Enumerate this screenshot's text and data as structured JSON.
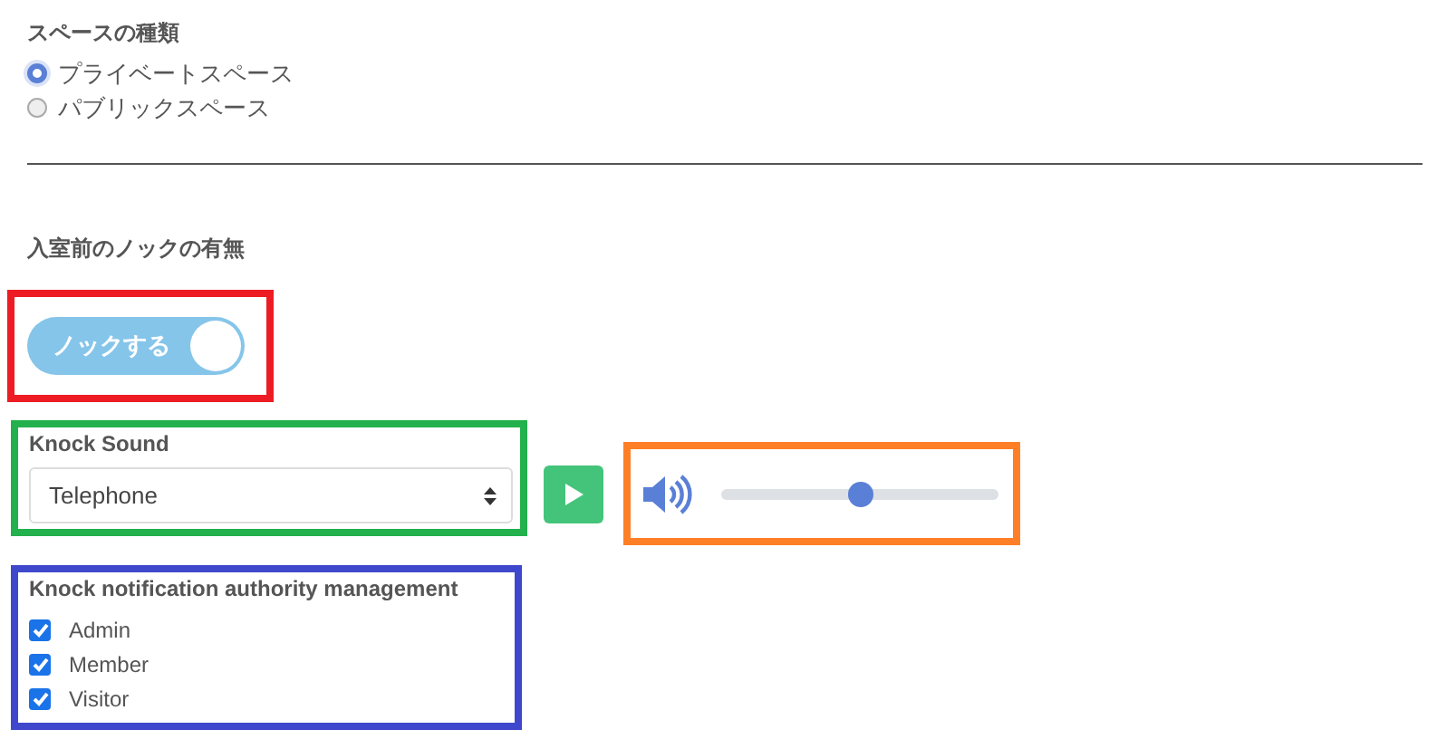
{
  "space_type": {
    "label": "スペースの種類",
    "options": [
      {
        "label": "プライベートスペース",
        "selected": true
      },
      {
        "label": "パブリックスペース",
        "selected": false
      }
    ]
  },
  "knock": {
    "label": "入室前のノックの有無",
    "toggle": {
      "label": "ノックする",
      "on": true
    }
  },
  "knock_sound": {
    "label": "Knock Sound",
    "value": "Telephone",
    "volume": {
      "level": 0.5
    }
  },
  "authority": {
    "label": "Knock notification authority management",
    "options": [
      {
        "label": "Admin",
        "checked": true
      },
      {
        "label": "Member",
        "checked": true
      },
      {
        "label": "Visitor",
        "checked": true
      }
    ]
  },
  "highlights": [
    {
      "color": "#ed1c24"
    },
    {
      "color": "#22b14c"
    },
    {
      "color": "#ff7f27"
    },
    {
      "color": "#3f48cc"
    }
  ]
}
